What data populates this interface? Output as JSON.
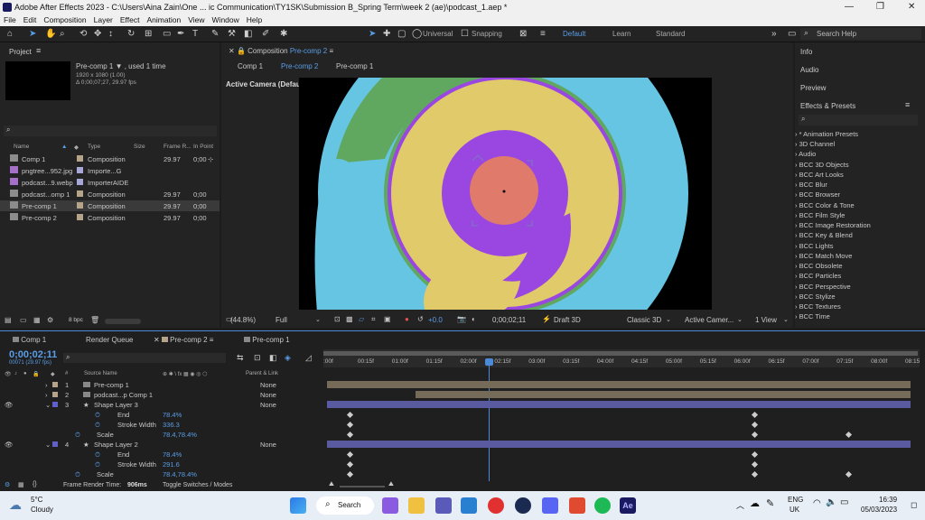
{
  "titlebar": {
    "title": "Adobe After Effects 2023 - C:\\Users\\Aina Zain\\One ... ic Communication\\TY1SK\\Submission B_Spring Term\\week 2 (ae)\\podcast_1.aep *"
  },
  "menu": [
    "File",
    "Edit",
    "Composition",
    "Layer",
    "Effect",
    "Animation",
    "View",
    "Window",
    "Help"
  ],
  "toolbar": {
    "universal": "Universal",
    "snapping": "Snapping",
    "ws_default": "Default",
    "ws_learn": "Learn",
    "ws_standard": "Standard",
    "search": "Search Help"
  },
  "project": {
    "title": "Project",
    "selected_name": "Pre-comp 1 ▼ , used 1 time",
    "selected_res": "1920 x 1080 (1.00)",
    "selected_dur": "Δ 0;00;07;27, 29.97 fps",
    "columns": [
      "Name",
      "Type",
      "Size",
      "Frame R...",
      "In Point"
    ],
    "items": [
      {
        "name": "Comp 1",
        "type": "Composition",
        "fps": "29.97",
        "in": "0;00"
      },
      {
        "name": "pngtree...952.jpg",
        "type": "Importe...G",
        "fps": "",
        "in": ""
      },
      {
        "name": "podcast...9.webp",
        "type": "ImporterAIDE",
        "fps": "",
        "in": ""
      },
      {
        "name": "podcast...omp 1",
        "type": "Composition",
        "fps": "29.97",
        "in": "0;00"
      },
      {
        "name": "Pre-comp 1",
        "type": "Composition",
        "fps": "29.97",
        "in": "0;00"
      },
      {
        "name": "Pre-comp 2",
        "type": "Composition",
        "fps": "29.97",
        "in": "0;00"
      }
    ],
    "bpc": "8 bpc"
  },
  "composition": {
    "tab_label": "Composition",
    "tab_name": "Pre-comp 2",
    "subtabs": [
      "Comp 1",
      "Pre-comp 2",
      "Pre-comp 1"
    ],
    "camera": "Active Camera (Default)",
    "zoom": "(44.8%)",
    "quality": "Full",
    "exposure": "+0.0",
    "timecode": "0;00;02;11",
    "renderer": "Draft 3D",
    "mode": "Classic 3D",
    "camera_select": "Active Camer...",
    "views": "1 View"
  },
  "right_panel": {
    "info": "Info",
    "audio": "Audio",
    "preview": "Preview",
    "effects": "Effects & Presets",
    "items": [
      "* Animation Presets",
      "3D Channel",
      "Audio",
      "BCC 3D Objects",
      "BCC Art Looks",
      "BCC Blur",
      "BCC Browser",
      "BCC Color & Tone",
      "BCC Film Style",
      "BCC Image Restoration",
      "BCC Key & Blend",
      "BCC Lights",
      "BCC Match Move",
      "BCC Obsolete",
      "BCC Particles",
      "BCC Perspective",
      "BCC Stylize",
      "BCC Textures",
      "BCC Time"
    ]
  },
  "timeline": {
    "tabs": [
      "Comp 1",
      "Render Queue",
      "Pre-comp 2",
      "Pre-comp 1"
    ],
    "timecode": "0;00;02;11",
    "frames": "00071 (29.97 fps)",
    "col_source": "Source Name",
    "col_parent": "Parent & Link",
    "ruler": [
      ":00f",
      "00:15f",
      "01:00f",
      "01:15f",
      "02:00f",
      "02:15f",
      "03:00f",
      "03:15f",
      "04:00f",
      "04:15f",
      "05:00f",
      "05:15f",
      "06:00f",
      "06:15f",
      "07:00f",
      "07:15f",
      "08:00f",
      "08:15"
    ],
    "layers": [
      {
        "num": "1",
        "name": "Pre-comp 1",
        "parent": "None"
      },
      {
        "num": "2",
        "name": "podcast...p Comp 1",
        "parent": "None"
      },
      {
        "num": "3",
        "name": "Shape Layer 3",
        "parent": "None"
      },
      {
        "prop": "End",
        "value": "78.4%"
      },
      {
        "prop": "Stroke Width",
        "value": "336.3"
      },
      {
        "prop": "Scale",
        "value": "78.4,78.4%"
      },
      {
        "num": "4",
        "name": "Shape Layer 2",
        "parent": "None"
      },
      {
        "prop": "End",
        "value": "78.4%"
      },
      {
        "prop": "Stroke Width",
        "value": "291.6"
      },
      {
        "prop": "Scale",
        "value": "78.4,78.4%"
      }
    ],
    "render_time_label": "Frame Render Time:",
    "render_time": "906ms",
    "toggle": "Toggle Switches / Modes"
  },
  "taskbar": {
    "temp": "5°C",
    "weather": "Cloudy",
    "search": "Search",
    "lang1": "ENG",
    "lang2": "UK",
    "time": "16:39",
    "date": "05/03/2023"
  }
}
